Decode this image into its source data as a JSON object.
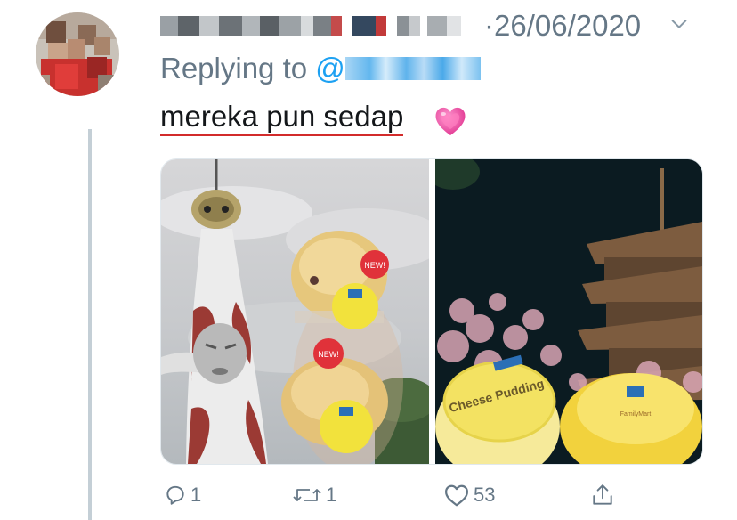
{
  "tweet": {
    "date": "·26/06/2020",
    "reply_prefix": "Replying to",
    "reply_at": "@",
    "text": "mereka pun sedap",
    "emoji": "growing-heart-emoji"
  },
  "actions": {
    "reply_count": "1",
    "retweet_count": "1",
    "like_count": "53"
  },
  "media": {
    "left_photo": "tower-and-cheesecake-photo",
    "right_photo": "pagoda-and-pudding-photo",
    "pudding_label": "Cheese Pudding",
    "new_badge": "NEW!",
    "brand": "FamilyMart"
  },
  "colors": {
    "muted": "#657786",
    "link": "#1da1f2",
    "text": "#14171a",
    "underline": "#d22b2b",
    "thread_line": "#c4cfd6"
  }
}
